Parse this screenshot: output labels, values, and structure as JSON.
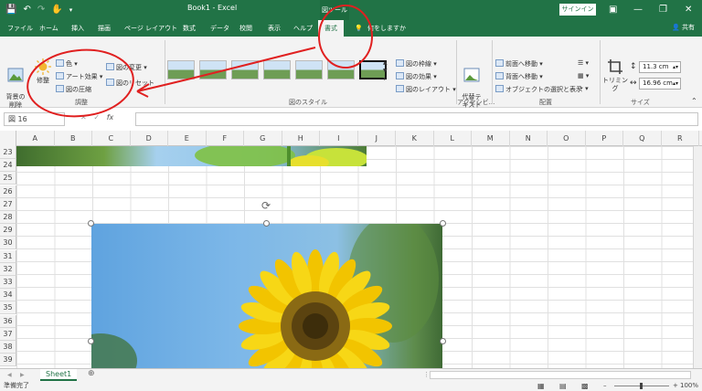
{
  "window": {
    "title": "Book1 - Excel",
    "tool_tab": "図ツール",
    "signin": "サインイン"
  },
  "tabs": [
    "ファイル",
    "ホーム",
    "挿入",
    "描画",
    "ページ レイアウト",
    "数式",
    "データ",
    "校閲",
    "表示",
    "ヘルプ",
    "書式",
    "何をしますか"
  ],
  "active_tab": "書式",
  "share_label": "共有",
  "ribbon": {
    "adjust": {
      "remove_bg": "背景の\n削除",
      "corrections": "修整",
      "color": "色",
      "art_effects": "アート効果",
      "compress": "図の圧縮",
      "change": "図の変更",
      "reset": "図のリセット",
      "group_label": "調整"
    },
    "styles": {
      "border": "図の枠線",
      "effects": "図の効果",
      "layout": "図のレイアウト",
      "group_label": "図のスタイル"
    },
    "accessibility": {
      "alt_text": "代替テ\nキスト",
      "group_label": "アクセシビ..."
    },
    "arrange": {
      "bring_forward": "前面へ移動",
      "send_backward": "背面へ移動",
      "selection_pane": "オブジェクトの選択と表示",
      "group_label": "配置"
    },
    "size": {
      "crop": "トリミング",
      "height": "11.3 cm",
      "width": "16.96 cm",
      "group_label": "サイズ"
    }
  },
  "formula_bar": {
    "name_box": "図 16",
    "fx": "fx",
    "value": ""
  },
  "columns": [
    "A",
    "B",
    "C",
    "D",
    "E",
    "F",
    "G",
    "H",
    "I",
    "J",
    "K",
    "L",
    "M",
    "N",
    "O",
    "P",
    "Q",
    "R"
  ],
  "rows": [
    "23",
    "24",
    "25",
    "26",
    "27",
    "28",
    "29",
    "30",
    "31",
    "32",
    "33",
    "34",
    "35",
    "36",
    "37",
    "38",
    "39"
  ],
  "sheet_tab": "Sheet1",
  "status": {
    "text": "準備完了",
    "zoom": "100%"
  },
  "colors": {
    "excel_green": "#217346",
    "annotation_red": "#e02020"
  }
}
